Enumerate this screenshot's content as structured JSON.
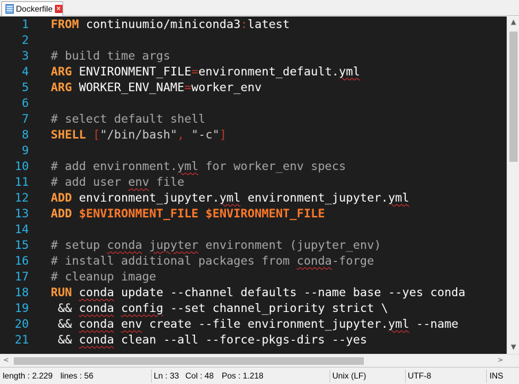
{
  "tab": {
    "label": "Dockerfile",
    "close_glyph": "×"
  },
  "lines": [
    {
      "n": "1",
      "html": "<span class=\"kw\">FROM</span> continuumio/miniconda3<span class=\"op\">:</span>latest"
    },
    {
      "n": "2",
      "html": ""
    },
    {
      "n": "3",
      "html": "<span class=\"cm\"># build time args</span>"
    },
    {
      "n": "4",
      "html": "<span class=\"kw\">ARG</span> ENVIRONMENT_FILE<span class=\"op\">=</span>environment_default.<span class=\"sq\">yml</span>"
    },
    {
      "n": "5",
      "html": "<span class=\"kw\">ARG</span> WORKER_ENV_NAME<span class=\"op\">=</span>worker_env"
    },
    {
      "n": "6",
      "html": ""
    },
    {
      "n": "7",
      "html": "<span class=\"cm\"># select default shell</span>"
    },
    {
      "n": "8",
      "html": "<span class=\"kw\">SHELL</span> <span class=\"op\">[</span><span class=\"str\">\"/bin/bash\"</span><span class=\"op\">,</span> <span class=\"str\">\"-c\"</span><span class=\"op\">]</span>"
    },
    {
      "n": "9",
      "html": ""
    },
    {
      "n": "10",
      "html": "<span class=\"cm\"># add environment.<span class=\"sq\">yml</span> for worker_env specs</span>"
    },
    {
      "n": "11",
      "html": "<span class=\"cm\"># add user <span class=\"sq\">env</span> file</span>"
    },
    {
      "n": "12",
      "html": "<span class=\"kw\">ADD</span> environment_jupyter.<span class=\"sq\">yml</span> environment_jupyter.<span class=\"sq\">yml</span>"
    },
    {
      "n": "13",
      "html": "<span class=\"kw\">ADD</span> <span class=\"var\">$ENVIRONMENT_FILE</span> <span class=\"var\">$ENVIRONMENT_FILE</span>"
    },
    {
      "n": "14",
      "html": ""
    },
    {
      "n": "15",
      "html": "<span class=\"cm\"># setup <span class=\"sq\">conda</span> <span class=\"sq\">jupyter</span> environment (jupyter_env)</span>"
    },
    {
      "n": "16",
      "html": "<span class=\"cm\"># install additional packages from <span class=\"sq\">conda</span>-forge</span>"
    },
    {
      "n": "17",
      "html": "<span class=\"cm\"># cleanup image</span>"
    },
    {
      "n": "18",
      "html": "<span class=\"kw\">RUN</span> <span class=\"sq\">conda</span> update --channel defaults --name base --yes conda"
    },
    {
      "n": "19",
      "html": " &amp;&amp; <span class=\"sq\">conda</span> <span class=\"sq\">config</span> --set channel_priority strict \\"
    },
    {
      "n": "20",
      "html": " &amp;&amp; <span class=\"sq\">conda</span> <span class=\"sq\">env</span> create --file environment_jupyter.<span class=\"sq\">yml</span> --name"
    },
    {
      "n": "21",
      "html": " &amp;&amp; <span class=\"sq\">conda</span> clean --all --force-pkgs-dirs --yes"
    }
  ],
  "scroll": {
    "up": "▲",
    "down": "▼",
    "left": "<",
    "right": ">"
  },
  "status": {
    "length": "length : 2.229",
    "lines": "lines : 56",
    "ln": "Ln : 33",
    "col": "Col : 48",
    "pos": "Pos : 1.218",
    "eol": "Unix (LF)",
    "encoding": "UTF-8",
    "mode": "INS"
  },
  "colors": {
    "background": "#1e1e1e",
    "keyword": "#ff9a3c",
    "line_number": "#2bb3e6",
    "comment": "#a8a8a8"
  }
}
